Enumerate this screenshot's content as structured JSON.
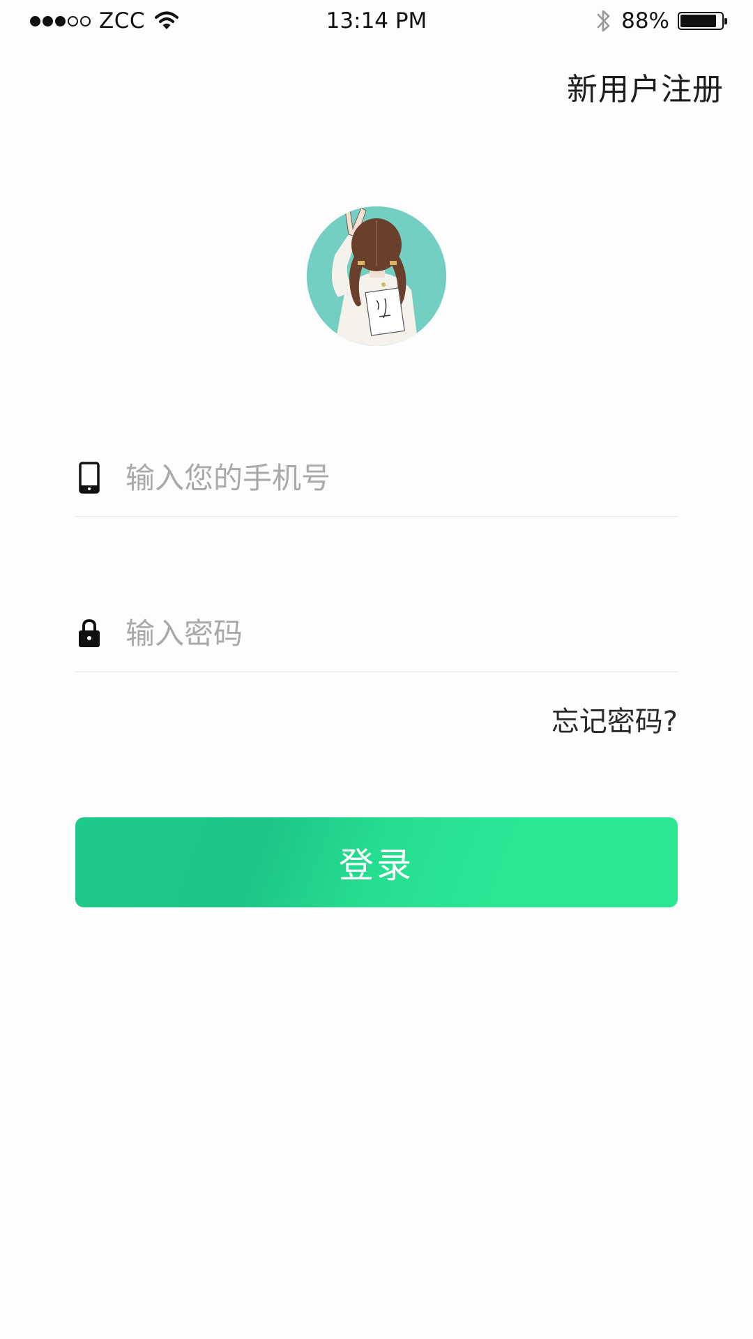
{
  "status_bar": {
    "carrier": "ZCC",
    "time": "13:14 PM",
    "battery_percent": "88%",
    "battery_level": 0.88,
    "signal_bars_filled": 3,
    "signal_bars_total": 5,
    "icons": [
      "signal-icon",
      "wifi-icon",
      "bluetooth-icon",
      "battery-icon"
    ]
  },
  "header": {
    "register_label": "新用户注册"
  },
  "avatar": {
    "icon": "avatar-illustration",
    "background_color": "#73cfc1"
  },
  "form": {
    "phone": {
      "placeholder": "输入您的手机号",
      "value": "",
      "icon": "phone-icon"
    },
    "password": {
      "placeholder": "输入密码",
      "value": "",
      "icon": "lock-icon"
    },
    "forgot_label": "忘记密码?",
    "login_label": "登录"
  },
  "colors": {
    "accent": "#22d68e",
    "accent_dark": "#1ec487",
    "text": "#222222",
    "placeholder": "#a9a9a9",
    "divider": "#e4e4e4"
  }
}
